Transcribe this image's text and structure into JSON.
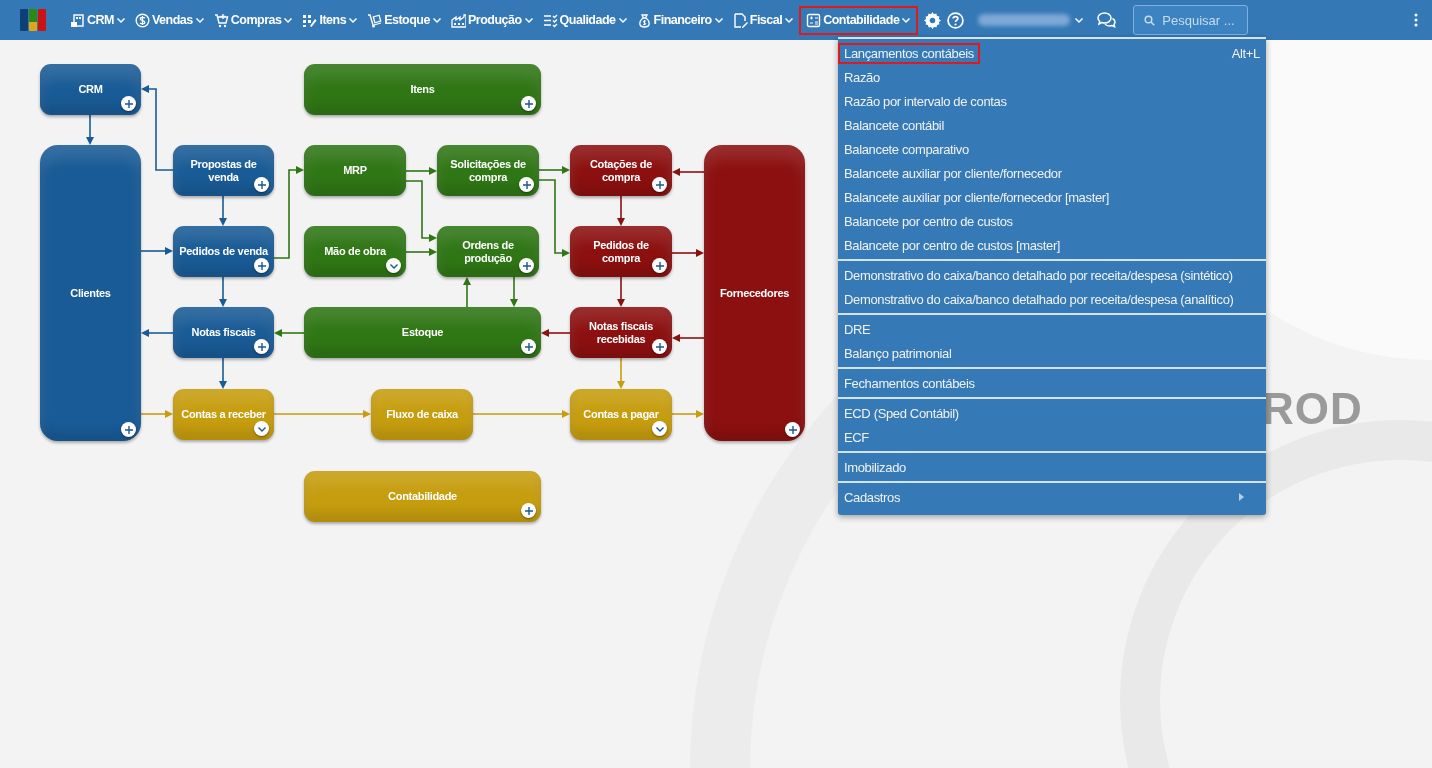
{
  "topbar": {
    "nav": [
      {
        "label": "CRM",
        "selected": false
      },
      {
        "label": "Vendas",
        "selected": false
      },
      {
        "label": "Compras",
        "selected": false
      },
      {
        "label": "Itens",
        "selected": false
      },
      {
        "label": "Estoque",
        "selected": false
      },
      {
        "label": "Produção",
        "selected": false
      },
      {
        "label": "Qualidade",
        "selected": false
      },
      {
        "label": "Financeiro",
        "selected": false
      },
      {
        "label": "Fiscal",
        "selected": false
      },
      {
        "label": "Contabilidade",
        "selected": true
      }
    ],
    "search": {
      "placeholder": "Pesquisar ..."
    }
  },
  "diagram": {
    "nodes": [
      {
        "label": "CRM",
        "color": "#195b96",
        "kind": "plus"
      },
      {
        "label": "Itens",
        "color": "#2f7615",
        "kind": "plus"
      },
      {
        "label": "Clientes",
        "color": "#195b96",
        "kind": "plus"
      },
      {
        "label": "Propostas de venda",
        "color": "#195b96",
        "kind": "plus"
      },
      {
        "label": "MRP",
        "color": "#2f7615",
        "kind": "plain"
      },
      {
        "label": "Solicitações de compra",
        "color": "#2f7615",
        "kind": "plus"
      },
      {
        "label": "Cotações de compra",
        "color": "#8c1010",
        "kind": "plus"
      },
      {
        "label": "Fornecedores",
        "color": "#8c1010",
        "kind": "plus"
      },
      {
        "label": "Pedidos de venda",
        "color": "#195b96",
        "kind": "plus"
      },
      {
        "label": "Mão de obra",
        "color": "#2f7615",
        "kind": "chevron"
      },
      {
        "label": "Ordens de produção",
        "color": "#2f7615",
        "kind": "plus"
      },
      {
        "label": "Pedidos de compra",
        "color": "#8c1010",
        "kind": "plus"
      },
      {
        "label": "Notas fiscais",
        "color": "#195b96",
        "kind": "plus"
      },
      {
        "label": "Estoque",
        "color": "#2f7615",
        "kind": "plus"
      },
      {
        "label": "Notas fiscais recebidas",
        "color": "#8c1010",
        "kind": "plus"
      },
      {
        "label": "Contas a receber",
        "color": "#c69d0e",
        "kind": "chevron"
      },
      {
        "label": "Fluxo de caixa",
        "color": "#c69d0e",
        "kind": "plain"
      },
      {
        "label": "Contas a pagar",
        "color": "#c69d0e",
        "kind": "chevron"
      },
      {
        "label": "Contabilidade",
        "color": "#c69d0e",
        "kind": "plus"
      }
    ],
    "background_text": "ROD"
  },
  "dropdown": {
    "groups": [
      [
        {
          "label": "Lançamentos contábeis",
          "shortcut": "Alt+L",
          "highlighted": true,
          "submenu": false
        },
        {
          "label": "Razão",
          "highlighted": false,
          "submenu": false
        },
        {
          "label": "Razão por intervalo de contas",
          "highlighted": false,
          "submenu": false
        },
        {
          "label": "Balancete contábil",
          "highlighted": false,
          "submenu": false
        },
        {
          "label": "Balancete comparativo",
          "highlighted": false,
          "submenu": false
        },
        {
          "label": "Balancete auxiliar por cliente/fornecedor",
          "highlighted": false,
          "submenu": false
        },
        {
          "label": "Balancete auxiliar por cliente/fornecedor [master]",
          "highlighted": false,
          "submenu": false
        },
        {
          "label": "Balancete por centro de custos",
          "highlighted": false,
          "submenu": false
        },
        {
          "label": "Balancete por centro de custos [master]",
          "highlighted": false,
          "submenu": false
        }
      ],
      [
        {
          "label": "Demonstrativo do caixa/banco detalhado por receita/despesa (sintético)",
          "highlighted": false,
          "submenu": false
        },
        {
          "label": "Demonstrativo do caixa/banco detalhado por receita/despesa (analítico)",
          "highlighted": false,
          "submenu": false
        }
      ],
      [
        {
          "label": "DRE",
          "highlighted": false,
          "submenu": false
        },
        {
          "label": "Balanço patrimonial",
          "highlighted": false,
          "submenu": false
        }
      ],
      [
        {
          "label": "Fechamentos contábeis",
          "highlighted": false,
          "submenu": false
        }
      ],
      [
        {
          "label": "ECD (Sped Contábil)",
          "highlighted": false,
          "submenu": false
        },
        {
          "label": "ECF",
          "highlighted": false,
          "submenu": false
        }
      ],
      [
        {
          "label": "Imobilizado",
          "highlighted": false,
          "submenu": false
        }
      ],
      [
        {
          "label": "Cadastros",
          "highlighted": false,
          "submenu": true
        }
      ]
    ]
  }
}
